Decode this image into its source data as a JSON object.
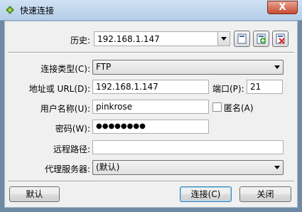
{
  "window": {
    "title": "快速连接",
    "close_symbol": "X"
  },
  "history": {
    "label": "历史:",
    "value": "192.168.1.147"
  },
  "toolbar_icons": [
    "bookmark-manager-icon",
    "add-bookmark-icon",
    "delete-bookmark-icon"
  ],
  "form": {
    "connection_type": {
      "label": "连接类型(C):",
      "value": "FTP"
    },
    "address": {
      "label": "地址或 URL(D):",
      "value": "192.168.1.147"
    },
    "port": {
      "label": "端口(P):",
      "value": "21"
    },
    "username": {
      "label": "用户名称(U):",
      "value": "pinkrose"
    },
    "anonymous": {
      "label": "匿名(A)",
      "checked": false
    },
    "password": {
      "label": "密码(W):",
      "value": "●●●●●●●●"
    },
    "remote_path": {
      "label": "远程路径:",
      "value": ""
    },
    "proxy": {
      "label": "代理服务器:",
      "value": "(默认)"
    }
  },
  "buttons": {
    "default": "默认",
    "connect": "连接(C)",
    "close": "关闭"
  }
}
